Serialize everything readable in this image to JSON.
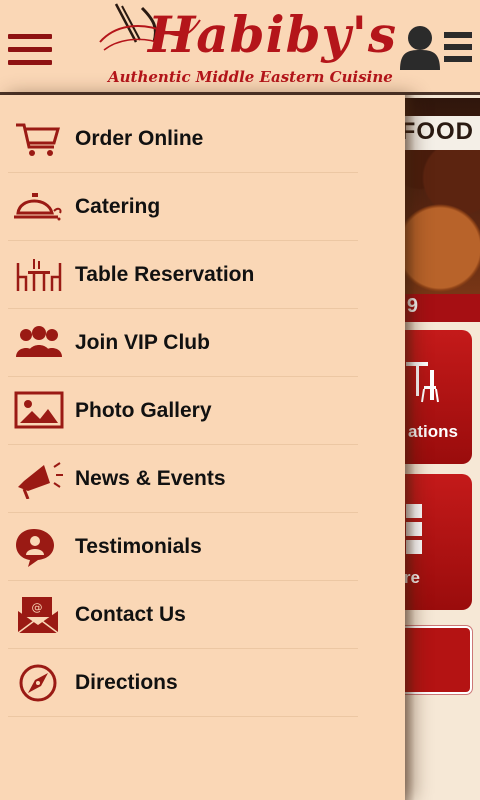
{
  "header": {
    "logo_title": "Habiby's",
    "logo_tagline": "Authentic Middle Eastern Cuisine",
    "menu_icon": "hamburger-icon",
    "user_icon": "user-list-icon"
  },
  "background": {
    "banner_title": "N FOOD",
    "banner_price": "9",
    "tile1_label": "ations",
    "tile2_label": "re"
  },
  "drawer": {
    "items": [
      {
        "label": "Order Online",
        "icon": "shopping-cart-icon"
      },
      {
        "label": "Catering",
        "icon": "serving-tray-icon"
      },
      {
        "label": "Table Reservation",
        "icon": "dining-table-icon"
      },
      {
        "label": "Join VIP Club",
        "icon": "group-people-icon"
      },
      {
        "label": "Photo Gallery",
        "icon": "picture-icon"
      },
      {
        "label": "News & Events",
        "icon": "megaphone-icon"
      },
      {
        "label": "Testimonials",
        "icon": "speech-person-icon"
      },
      {
        "label": "Contact Us",
        "icon": "envelope-icon"
      },
      {
        "label": "Directions",
        "icon": "compass-icon"
      }
    ]
  },
  "colors": {
    "brand_red": "#b4151a",
    "dark_red": "#8e1212",
    "drawer_bg": "#fad7b6",
    "text": "#111111"
  }
}
